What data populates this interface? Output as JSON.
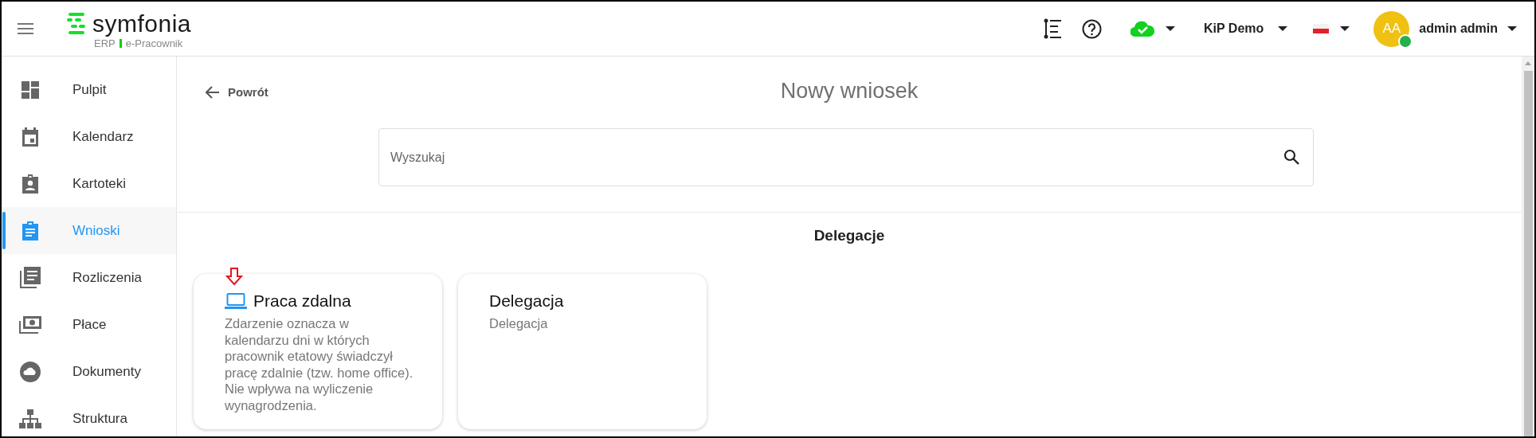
{
  "header": {
    "brand": "symfonia",
    "product": "ERP",
    "module": "e-Pracownik",
    "company": "KiP Demo",
    "avatar_initials": "AA",
    "user_name": "admin admin",
    "online": true
  },
  "sidebar": {
    "items": [
      {
        "label": "Pulpit",
        "kind": "dashboard",
        "selected": false
      },
      {
        "label": "Kalendarz",
        "kind": "calendar",
        "selected": false
      },
      {
        "label": "Kartoteki",
        "kind": "badge",
        "selected": false
      },
      {
        "label": "Wnioski",
        "kind": "clipboard",
        "selected": true
      },
      {
        "label": "Rozliczenia",
        "kind": "documents",
        "selected": false
      },
      {
        "label": "Płace",
        "kind": "money",
        "selected": false
      },
      {
        "label": "Dokumenty",
        "kind": "cloud",
        "selected": false
      },
      {
        "label": "Struktura",
        "kind": "hierarchy",
        "selected": false
      }
    ]
  },
  "page": {
    "back": "Powrót",
    "title": "Nowy wniosek",
    "search": {
      "placeholder": "Wyszukaj"
    },
    "section": "Delegacje",
    "cards": [
      {
        "title": "Praca zdalna",
        "description": "Zdarzenie oznacza w kalendarzu dni w których pracownik etatowy świadczył pracę zdalnie (tzw. home office). Nie wpływa na wyliczenie wynagrodzenia.",
        "kind": "laptop",
        "marked": true
      },
      {
        "title": "Delegacja",
        "description": "Delegacja",
        "kind": "plain",
        "marked": false
      }
    ]
  }
}
